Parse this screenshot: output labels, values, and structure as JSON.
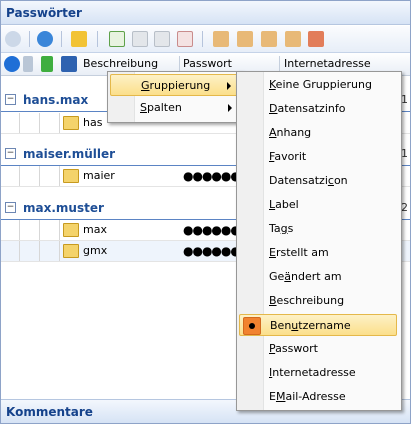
{
  "panel": {
    "title": "Passwörter",
    "footer_title": "Kommentare"
  },
  "toolbar": {
    "icons": [
      "view-icon",
      "refresh-icon",
      "lock-icon",
      "new-entry-icon",
      "edit-icon",
      "copy-icon",
      "delete-icon",
      "clip-user-icon",
      "clip-password-icon",
      "clip-url-icon",
      "open-url-icon",
      "autotype-icon"
    ]
  },
  "columns": {
    "beschreibung": "Beschreibung",
    "passwort": "Passwort",
    "internetadresse": "Internetadresse"
  },
  "groups": [
    {
      "name": "hans.max",
      "count": "1",
      "rows": [
        {
          "name": "has",
          "password": ""
        }
      ]
    },
    {
      "name": "maiser.müller",
      "count": "1",
      "rows": [
        {
          "name": "maier",
          "password": "●●●●●●●●●●"
        }
      ]
    },
    {
      "name": "max.muster",
      "count": "2",
      "rows": [
        {
          "name": "max",
          "password": "●●●●●●●●●●"
        },
        {
          "name": "gmx",
          "password": "●●●●●●●●●●"
        }
      ]
    }
  ],
  "context_menu": {
    "items": [
      {
        "pre": "",
        "key": "G",
        "post": "ruppierung"
      },
      {
        "pre": "",
        "key": "S",
        "post": "palten"
      }
    ]
  },
  "submenu": {
    "items": [
      {
        "pre": "",
        "key": "K",
        "post": "eine Gruppierung"
      },
      {
        "pre": "",
        "key": "D",
        "post": "atensatzinfo"
      },
      {
        "pre": "",
        "key": "A",
        "post": "nhang"
      },
      {
        "pre": "",
        "key": "F",
        "post": "avorit"
      },
      {
        "pre": "Datensatzi",
        "key": "c",
        "post": "on"
      },
      {
        "pre": "",
        "key": "L",
        "post": "abel"
      },
      {
        "pre": "Ta",
        "key": "g",
        "post": "s"
      },
      {
        "pre": "",
        "key": "E",
        "post": "rstellt am"
      },
      {
        "pre": "Ge",
        "key": "ä",
        "post": "ndert am"
      },
      {
        "pre": "",
        "key": "B",
        "post": "eschreibung"
      },
      {
        "pre": "Ben",
        "key": "u",
        "post": "tzername"
      },
      {
        "pre": "",
        "key": "P",
        "post": "asswort"
      },
      {
        "pre": "",
        "key": "I",
        "post": "nternetadresse"
      },
      {
        "pre": "E",
        "key": "M",
        "post": "ail-Adresse"
      }
    ]
  }
}
